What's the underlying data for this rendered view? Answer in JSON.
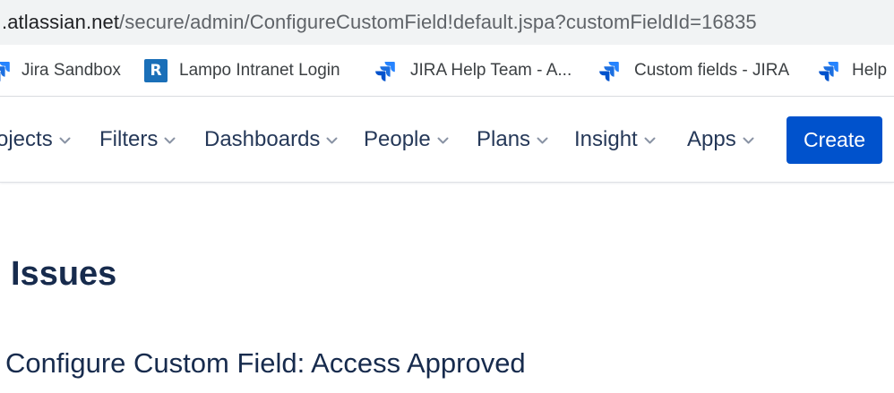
{
  "address_bar": {
    "url_host": ".atlassian.net",
    "url_path": "/secure/admin/ConfigureCustomField!default.jspa?customFieldId=16835"
  },
  "bookmarks": [
    {
      "label": "Jira Sandbox",
      "icon": "jira-icon"
    },
    {
      "label": "Lampo Intranet Login",
      "icon": "r-logo-icon",
      "icon_text": "R"
    },
    {
      "label": "JIRA Help Team - A...",
      "icon": "jira-icon"
    },
    {
      "label": "Custom fields - JIRA",
      "icon": "jira-icon"
    },
    {
      "label": "Help",
      "icon": "jira-icon"
    }
  ],
  "nav": {
    "items": [
      {
        "label": "ojects"
      },
      {
        "label": "Filters"
      },
      {
        "label": "Dashboards"
      },
      {
        "label": "People"
      },
      {
        "label": "Plans"
      },
      {
        "label": "Insight"
      },
      {
        "label": "Apps"
      }
    ],
    "create_label": "Create"
  },
  "page": {
    "title": "Issues",
    "subtitle": "Configure Custom Field: Access Approved"
  },
  "colors": {
    "accent": "#0052cc",
    "jira_blue": "#2684ff",
    "text": "#172b4d"
  }
}
